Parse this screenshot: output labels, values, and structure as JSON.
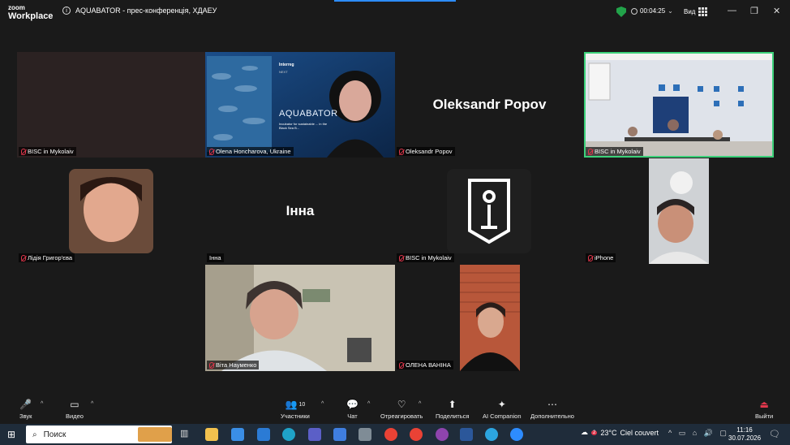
{
  "app": {
    "brand_top": "zoom",
    "brand_bottom": "Workplace",
    "meeting_title": "AQUABATOR - прес-конференція, ХДАЕУ"
  },
  "titlebar": {
    "timer": "00:04:25",
    "view_label": "Вид"
  },
  "tiles": [
    {
      "name": "BISC in Mykolaiv",
      "big": ""
    },
    {
      "name": "Olena Honcharova, Ukraine",
      "big": ""
    },
    {
      "name": "Oleksandr Popov",
      "big": "Oleksandr Popov"
    },
    {
      "name": "BISC in Mykolaiv",
      "big": ""
    },
    {
      "name": "Лідія Григор'єва",
      "big": ""
    },
    {
      "name": "Інна",
      "big": "Інна"
    },
    {
      "name": "BISC in Mykolaiv",
      "big": ""
    },
    {
      "name": "iPhone",
      "big": ""
    },
    {
      "name": "Віта Науменко",
      "big": ""
    },
    {
      "name": "ОЛЕНА ВАНІНА",
      "big": ""
    }
  ],
  "slide": {
    "title": "AQUABATOR",
    "subtitle": "Incubator for sustainable ... in the Black Sea B...",
    "logo": "Interreg",
    "next": "NEXT"
  },
  "toolbar": {
    "audio": "Звук",
    "video": "Видео",
    "participants": "Участники",
    "participants_count": "10",
    "chat": "Чат",
    "react": "Отреагировать",
    "share": "Поделиться",
    "ai": "AI Companion",
    "more": "Дополнительно",
    "leave": "Выйти"
  },
  "taskbar": {
    "search": "Поиск",
    "temperature": "23°C",
    "weather": "Ciel couvert",
    "badge": "2",
    "time": "11:16",
    "date": "30.07.2026"
  },
  "colors": {
    "active_speaker": "#3cd17a",
    "muted": "#e0374c",
    "accent": "#2d8cff"
  }
}
